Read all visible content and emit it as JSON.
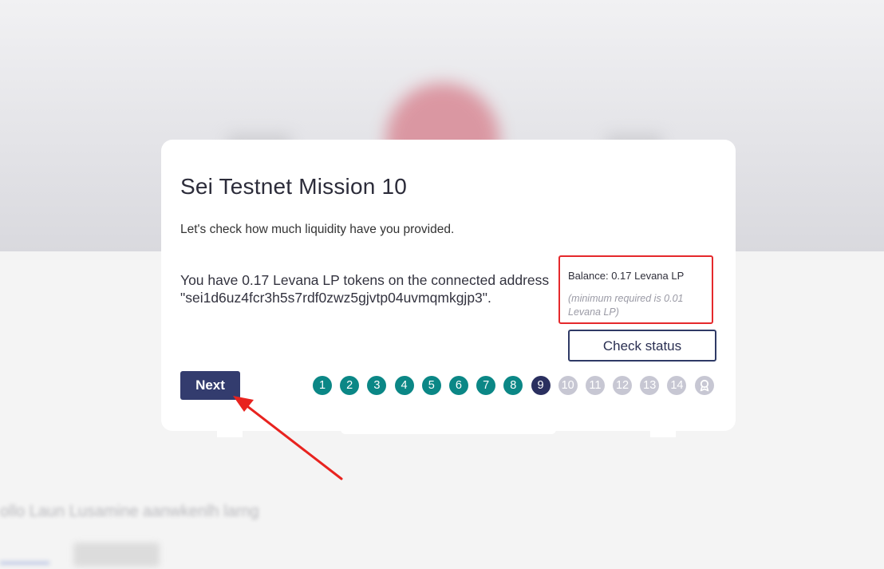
{
  "modal": {
    "title": "Sei Testnet Mission 10",
    "subtitle": "Let's check how much liquidity have you provided.",
    "message_line1": "You have 0.17 Levana LP tokens on the connected address",
    "message_line2": "\"sei1d6uz4fcr3h5s7rdf0zwz5gjvtp04uvmqmkgjp3\".",
    "balance": "Balance: 0.17 Levana LP",
    "minimum_note": "(minimum required is 0.01 Levana LP)",
    "check_status_label": "Check status",
    "next_label": "Next"
  },
  "steps": [
    {
      "label": "1",
      "state": "done"
    },
    {
      "label": "2",
      "state": "done"
    },
    {
      "label": "3",
      "state": "done"
    },
    {
      "label": "4",
      "state": "done"
    },
    {
      "label": "5",
      "state": "done"
    },
    {
      "label": "6",
      "state": "done"
    },
    {
      "label": "7",
      "state": "done"
    },
    {
      "label": "8",
      "state": "done"
    },
    {
      "label": "9",
      "state": "current"
    },
    {
      "label": "10",
      "state": "todo"
    },
    {
      "label": "11",
      "state": "todo"
    },
    {
      "label": "12",
      "state": "todo"
    },
    {
      "label": "13",
      "state": "todo"
    },
    {
      "label": "14",
      "state": "todo"
    },
    {
      "label": "",
      "state": "todo",
      "icon": "award-icon"
    }
  ],
  "background": {
    "text": "ollo Laun Lusamine aanwkenlh larng"
  },
  "colors": {
    "step_done": "#0b8786",
    "step_current": "#2a2f5f",
    "step_todo": "#c7c7d3",
    "next_button": "#333c6e",
    "highlight_box": "#e5292c",
    "annotation_arrow": "#e8231f"
  }
}
